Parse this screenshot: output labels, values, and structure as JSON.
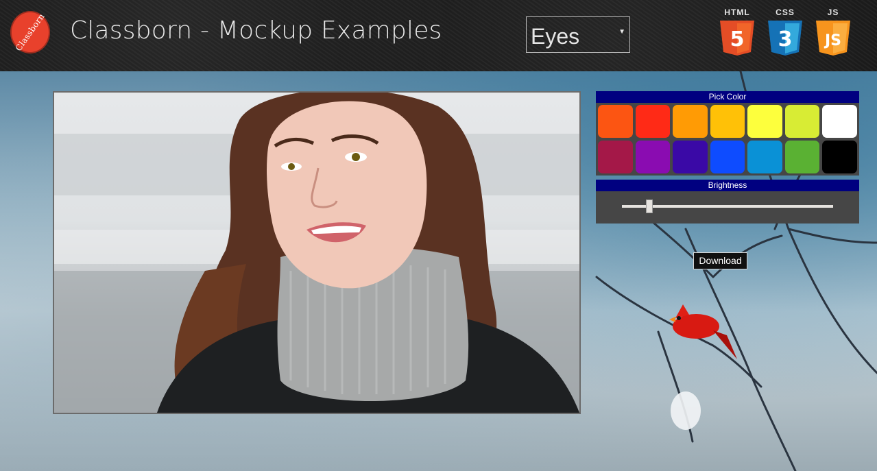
{
  "header": {
    "logo_text": "Classborn",
    "title": "Classborn - Mockup Examples",
    "feature_select": {
      "selected": "Eyes"
    },
    "tech_badges": [
      {
        "label": "HTML",
        "number": "5",
        "color": "#e44d26",
        "icon": "html5-icon"
      },
      {
        "label": "CSS",
        "number": "3",
        "color": "#1572b6",
        "icon": "css3-icon"
      },
      {
        "label": "JS",
        "number": "JS",
        "color": "#f7941d",
        "icon": "js-icon"
      }
    ]
  },
  "color_panel": {
    "title": "Pick Color",
    "swatches": [
      "#fc5512",
      "#ff2a16",
      "#ff9b05",
      "#ffc107",
      "#fdff3d",
      "#d8ec34",
      "#ffffff",
      "#a41848",
      "#8a0cb1",
      "#3a09a6",
      "#0e4cff",
      "#0a91d6",
      "#5ab133",
      "#000000"
    ]
  },
  "brightness": {
    "title": "Brightness",
    "value": 0.13
  },
  "download_label": "Download",
  "colors": {
    "panel_header": "#000080",
    "panel_bg": "#464646"
  }
}
